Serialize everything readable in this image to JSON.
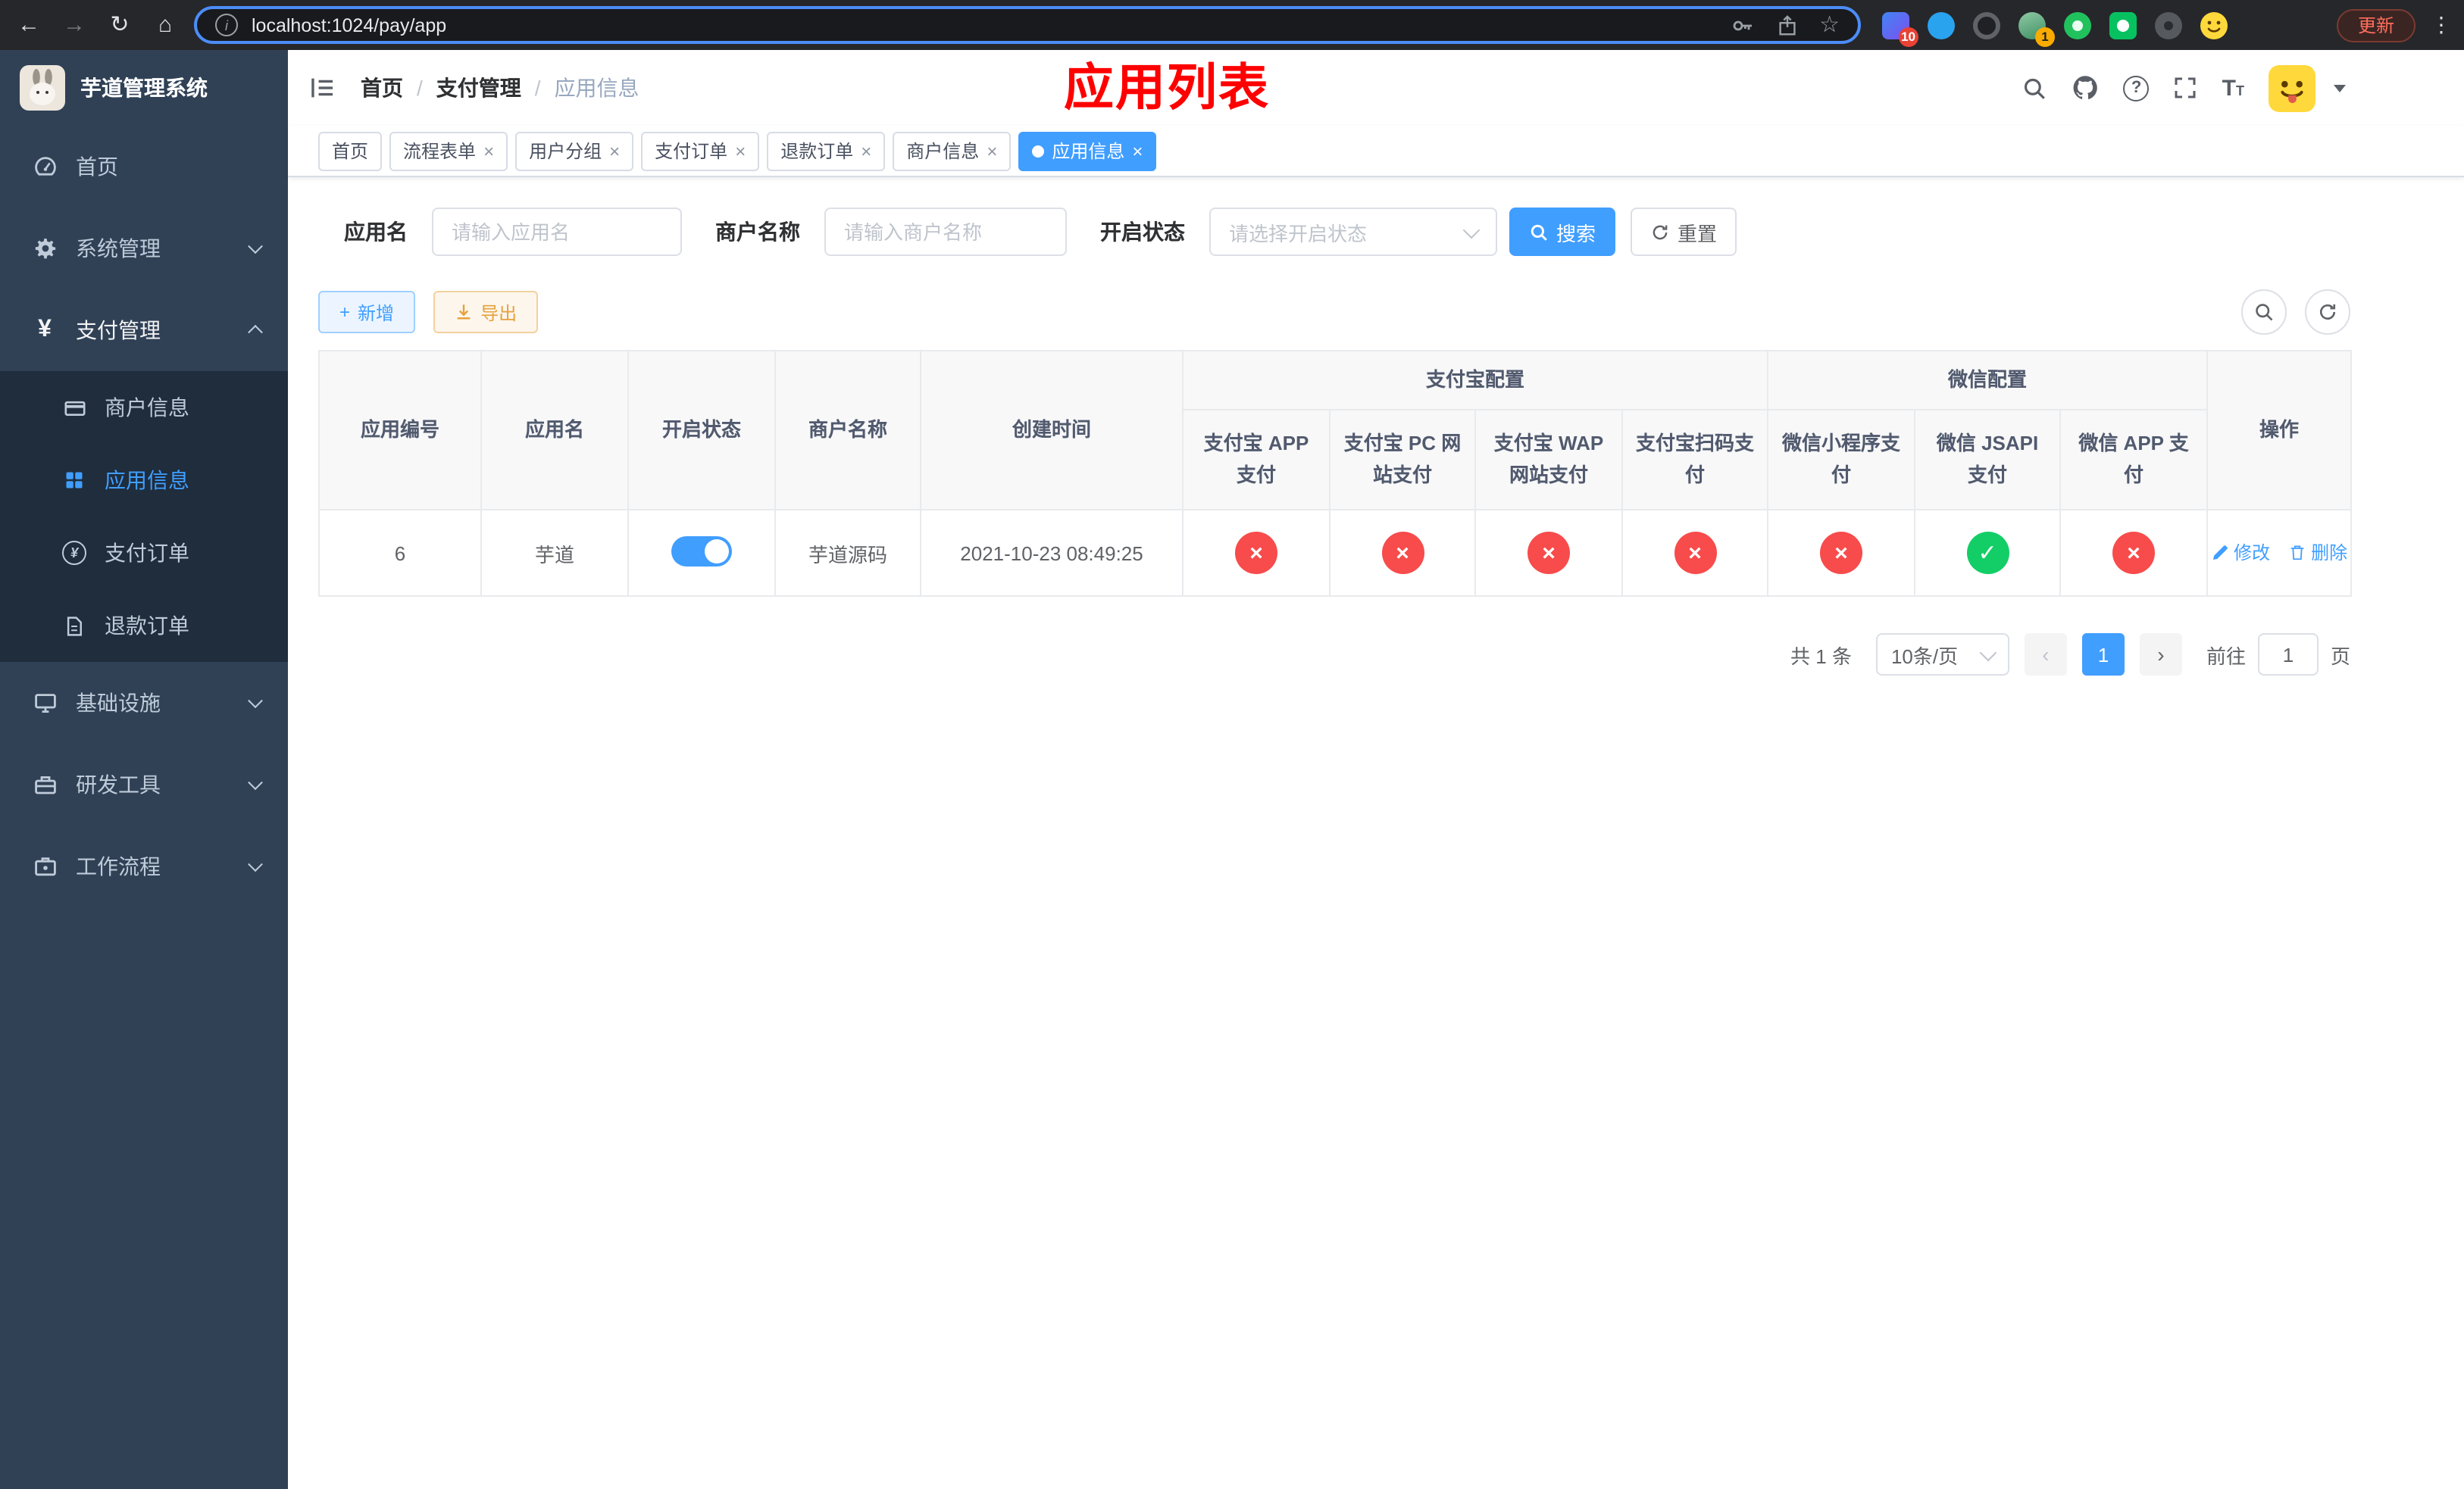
{
  "browser": {
    "url": "localhost:1024/pay/app",
    "update_label": "更新",
    "extension_badge_count": "10",
    "profile_badge_count": "1"
  },
  "glyphs": {
    "back": "←",
    "forward": "→",
    "reload": "↻",
    "home": "⌂",
    "info": "i",
    "star": "☆",
    "kebab": "⋮",
    "close": "×",
    "plus": "+",
    "prev": "‹",
    "next": "›",
    "question": "?",
    "yen": "¥"
  },
  "sidebar": {
    "app_title": "芋道管理系统",
    "home": "首页",
    "system": "系统管理",
    "payment": "支付管理",
    "merchant_info": "商户信息",
    "app_info": "应用信息",
    "pay_order": "支付订单",
    "refund_order": "退款订单",
    "infrastructure": "基础设施",
    "dev_tools": "研发工具",
    "workflow": "工作流程"
  },
  "header": {
    "breadcrumb": [
      "首页",
      "支付管理",
      "应用信息"
    ],
    "page_title": "应用列表"
  },
  "tabs": [
    {
      "label": "首页"
    },
    {
      "label": "流程表单"
    },
    {
      "label": "用户分组"
    },
    {
      "label": "支付订单"
    },
    {
      "label": "退款订单"
    },
    {
      "label": "商户信息"
    },
    {
      "label": "应用信息"
    }
  ],
  "filters": {
    "app_name_label": "应用名",
    "app_name_placeholder": "请输入应用名",
    "merchant_name_label": "商户名称",
    "merchant_name_placeholder": "请输入商户名称",
    "status_label": "开启状态",
    "status_placeholder": "请选择开启状态",
    "search_label": "搜索",
    "reset_label": "重置"
  },
  "toolbar": {
    "add_label": "新增",
    "export_label": "导出"
  },
  "table": {
    "headers": {
      "app_id": "应用编号",
      "app_name": "应用名",
      "status": "开启状态",
      "merchant_name": "商户名称",
      "create_time": "创建时间",
      "alipay_group": "支付宝配置",
      "wechat_group": "微信配置",
      "alipay_app": "支付宝 APP 支付",
      "alipay_pc": "支付宝 PC 网站支付",
      "alipay_wap": "支付宝 WAP 网站支付",
      "alipay_qr": "支付宝扫码支付",
      "wechat_mini": "微信小程序支付",
      "wechat_jsapi": "微信 JSAPI 支付",
      "wechat_app": "微信 APP 支付",
      "actions": "操作"
    },
    "row": {
      "app_id": "6",
      "app_name": "芋道",
      "status_enabled": true,
      "merchant_name": "芋道源码",
      "create_time": "2021-10-23 08:49:25",
      "alipay_app": "×",
      "alipay_pc": "×",
      "alipay_wap": "×",
      "alipay_qr": "×",
      "wechat_mini": "×",
      "wechat_jsapi": "✓",
      "wechat_app": "×",
      "edit_label": "修改",
      "delete_label": "删除"
    }
  },
  "pagination": {
    "total_text": "共 1 条",
    "page_size": "10条/页",
    "current_page": "1",
    "goto_label": "前往",
    "goto_value": "1",
    "goto_unit": "页"
  },
  "colors": {
    "primary": "#409eff",
    "danger": "#f84b4b",
    "success": "#13ce66",
    "title_red": "#ff0000"
  }
}
